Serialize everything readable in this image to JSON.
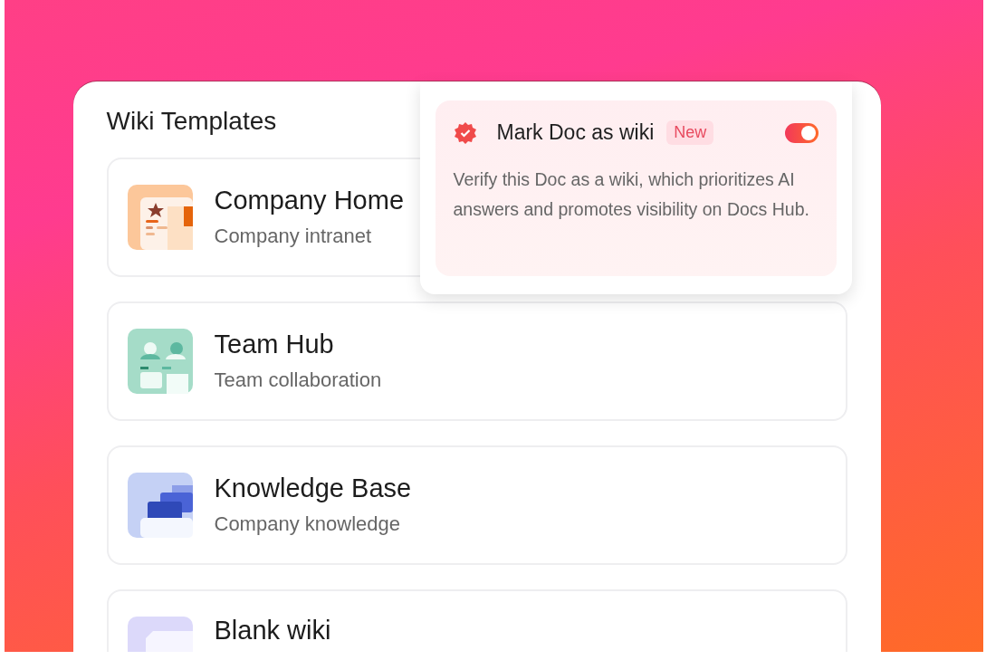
{
  "panel": {
    "title": "Wiki Templates"
  },
  "templates": [
    {
      "kind": "home",
      "title": "Company Home",
      "subtitle": "Company intranet"
    },
    {
      "kind": "team",
      "title": "Team Hub",
      "subtitle": "Team collaboration"
    },
    {
      "kind": "knowledge",
      "title": "Knowledge Base",
      "subtitle": "Company knowledge"
    },
    {
      "kind": "blank",
      "title": "Blank wiki"
    }
  ],
  "popup": {
    "title": "Mark Doc as wiki",
    "badge": "New",
    "on": true,
    "description": "Verify this Doc as a wiki, which prioritizes AI answers and promotes visibility on Docs Hub."
  }
}
